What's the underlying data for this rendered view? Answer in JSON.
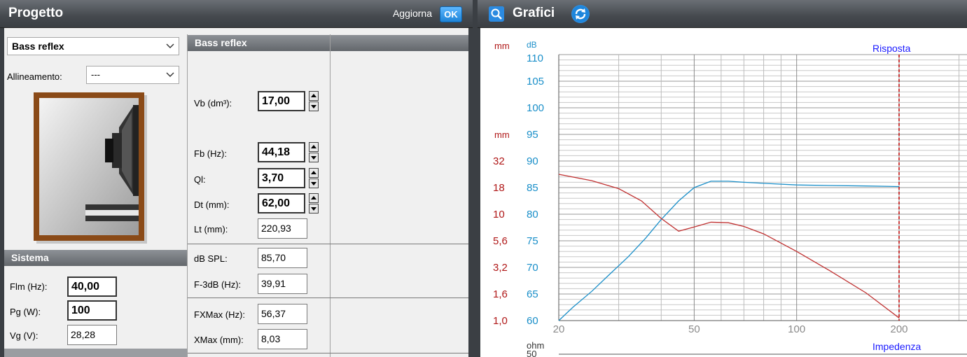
{
  "progetto": {
    "title": "Progetto",
    "aggiorna_label": "Aggiorna",
    "ok_label": "OK",
    "enclosure_type": "Bass reflex",
    "allineamento_label": "Allineamento:",
    "allineamento_value": "---",
    "section_header": "Bass reflex",
    "vb_label": "Vb (dm³):",
    "vb_value": "17,00",
    "fb_label": "Fb (Hz):",
    "fb_value": "44,18",
    "ql_label": "Ql:",
    "ql_value": "3,70",
    "dt_label": "Dt (mm):",
    "dt_value": "62,00",
    "lt_label": "Lt (mm):",
    "lt_value": "220,93",
    "dbspl_label": "dB SPL:",
    "dbspl_value": "85,70",
    "f3db_label": "F-3dB (Hz):",
    "f3db_value": "39,91",
    "fxmax_label": "FXMax (Hz):",
    "fxmax_value": "56,37",
    "xmax_label": "XMax (mm):",
    "xmax_value": "8,03"
  },
  "sistema": {
    "header": "Sistema",
    "flm_label": "Flm (Hz):",
    "flm_value": "40,00",
    "pg_label": "Pg (W):",
    "pg_value": "100",
    "vg_label": "Vg (V):",
    "vg_value": "28,28"
  },
  "grafici": {
    "title": "Grafici",
    "mm_unit_top": "mm",
    "db_unit": "dB",
    "mm_unit": "mm",
    "ohm_unit": "ohm",
    "ohm_top_tick": "50",
    "risposta_label": "Risposta",
    "impedenza_label": "Impedenza",
    "db_ticks": [
      "110",
      "105",
      "100",
      "95",
      "90",
      "85",
      "80",
      "75",
      "70",
      "65",
      "60"
    ],
    "mm_ticks": [
      "32",
      "18",
      "10",
      "5,6",
      "3,2",
      "1,6",
      "1,0"
    ],
    "freq_ticks": [
      "20",
      "50",
      "100",
      "200"
    ],
    "colors": {
      "db_axis": "#1a8fc9",
      "mm_axis": "#b01818",
      "label_blue": "#1a1aff"
    }
  },
  "chart_data": {
    "type": "line",
    "xlabel": "",
    "ylabel": "dB",
    "xscale": "log",
    "x_ticks": [
      20,
      50,
      100,
      200
    ],
    "ylim": [
      60,
      110
    ],
    "y_ticks": [
      60,
      65,
      70,
      75,
      80,
      85,
      90,
      95,
      100,
      105,
      110
    ],
    "y2_ticks": [
      1.0,
      1.6,
      3.2,
      5.6,
      10,
      18,
      32
    ],
    "marker_x": 200,
    "series": [
      {
        "axis": "dB",
        "color": "#1a8fc9",
        "x": [
          20,
          22,
          25,
          28,
          32,
          36,
          40,
          45,
          50,
          56,
          63,
          70,
          80,
          100,
          125,
          160,
          200
        ],
        "y": [
          60,
          62.5,
          65.5,
          68.5,
          72,
          75.5,
          79,
          82.5,
          85,
          86.2,
          86.2,
          86,
          85.8,
          85.5,
          85.4,
          85.3,
          85.2
        ]
      },
      {
        "axis": "mm",
        "color": "#c03030",
        "x": [
          20,
          25,
          30,
          35,
          40,
          45,
          50,
          56,
          63,
          70,
          80,
          100,
          125,
          160,
          200
        ],
        "y": [
          87.5,
          86.3,
          84.8,
          82.5,
          79.2,
          76.8,
          77.6,
          78.5,
          78.4,
          77.7,
          76.3,
          73,
          69.4,
          65.2,
          60.5
        ]
      }
    ]
  }
}
